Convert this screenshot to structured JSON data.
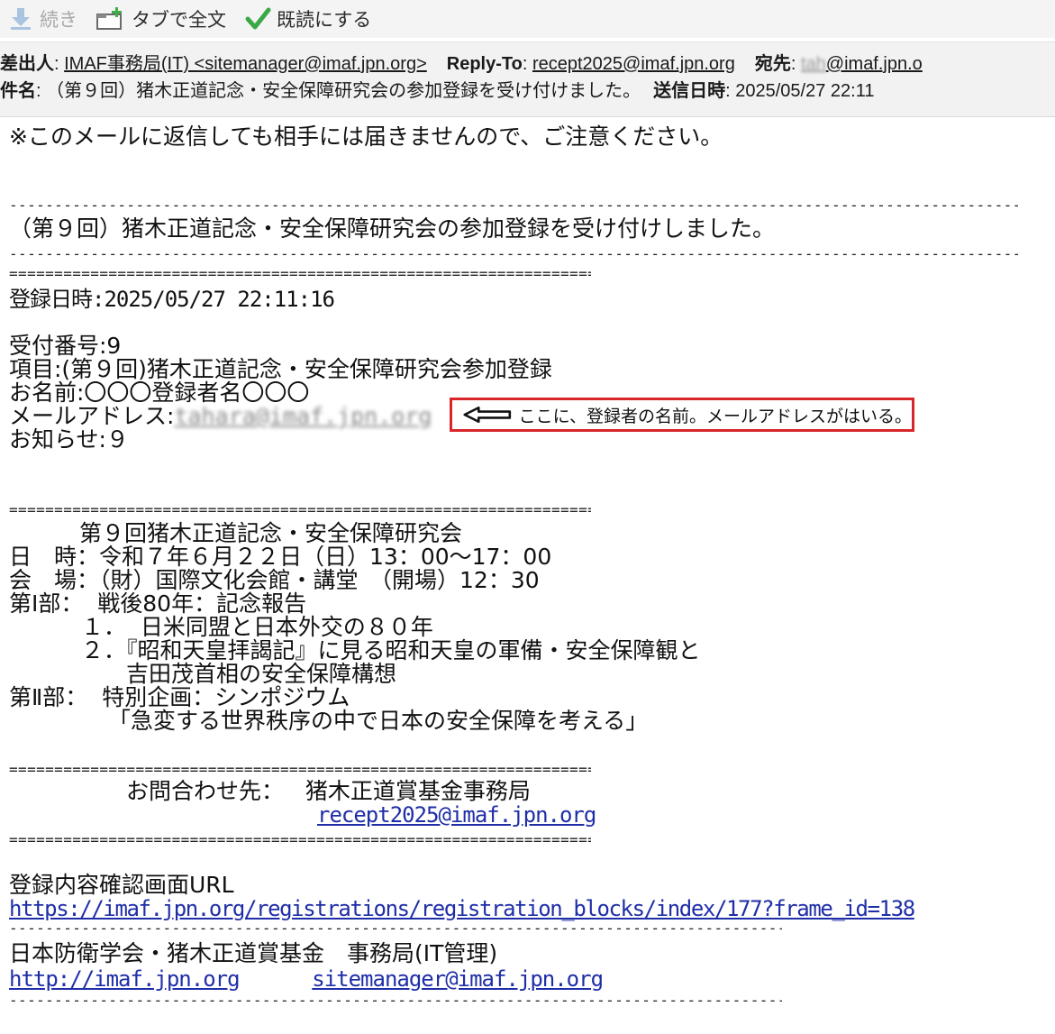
{
  "toolbar": {
    "continue_label": "続き",
    "new_tab_label": "タブで全文",
    "mark_read_label": "既読にする"
  },
  "header": {
    "from_label": "差出人",
    "from_value": "IMAF事務局(IT) <sitemanager@imaf.jpn.org>",
    "reply_to_label": "Reply-To",
    "reply_to_value": "recept2025@imaf.jpn.org",
    "to_label": "宛先",
    "to_value_visible": "@imaf.jpn.o",
    "subject_label": "件名",
    "subject_value": "（第９回）猪木正道記念・安全保障研究会の参加登録を受け付けました。",
    "date_label": "送信日時",
    "date_value": "2025/05/27 22:11"
  },
  "body": {
    "notice": "※このメールに返信しても相手には届きませんので、ご注意ください。",
    "banner": "（第９回）猪木正道記念・安全保障研究会の参加登録を受け付けしました。",
    "reg_datetime": "登録日時:2025/05/27 22:11:16",
    "receipt_no": "受付番号:9",
    "item": "項目:(第９回)猪木正道記念・安全保障研究会参加登録",
    "name": "お名前:〇〇〇登録者名〇〇〇",
    "email_label": "メールアドレス:",
    "notice_no": "お知らせ:９",
    "event_title": "第９回猪木正道記念・安全保障研究会",
    "event_datetime": "日　時：令和７年６月２２日（日）13：00～17：00",
    "event_venue": "会　場：（財）国際文化会館・講堂　（開場）12：30",
    "part1": "第Ⅰ部：  戦後80年：記念報告",
    "part1_item1": "１．  日米同盟と日本外交の８０年",
    "part1_item2": "２．『昭和天皇拝謁記』に見る昭和天皇の軍備・安全保障観と",
    "part1_item2b": "吉田茂首相の安全保障構想",
    "part2": "第Ⅱ部：  特別企画：シンポジウム",
    "part2_title": "「急変する世界秩序の中で日本の安全保障を考える」",
    "contact_label": "お問合わせ先：   猪木正道賞基金事務局",
    "contact_email": "recept2025@imaf.jpn.org",
    "confirm_url_label": "登録内容確認画面URL",
    "confirm_url": "https://imaf.jpn.org/registrations/registration_blocks/index/177?frame_id=138",
    "footer_org": "日本防衛学会・猪木正道賞基金　事務局(IT管理)",
    "footer_site": "http://imaf.jpn.org",
    "footer_email": "sitemanager@imaf.jpn.org"
  },
  "annotation": {
    "text": "ここに、登録者の名前。メールアドレスがはいる。",
    "border_color": "#d8262b"
  },
  "icons": {
    "continue": "download-arrow-icon",
    "new_tab": "new-tab-icon",
    "mark_read": "checkmark-icon"
  }
}
